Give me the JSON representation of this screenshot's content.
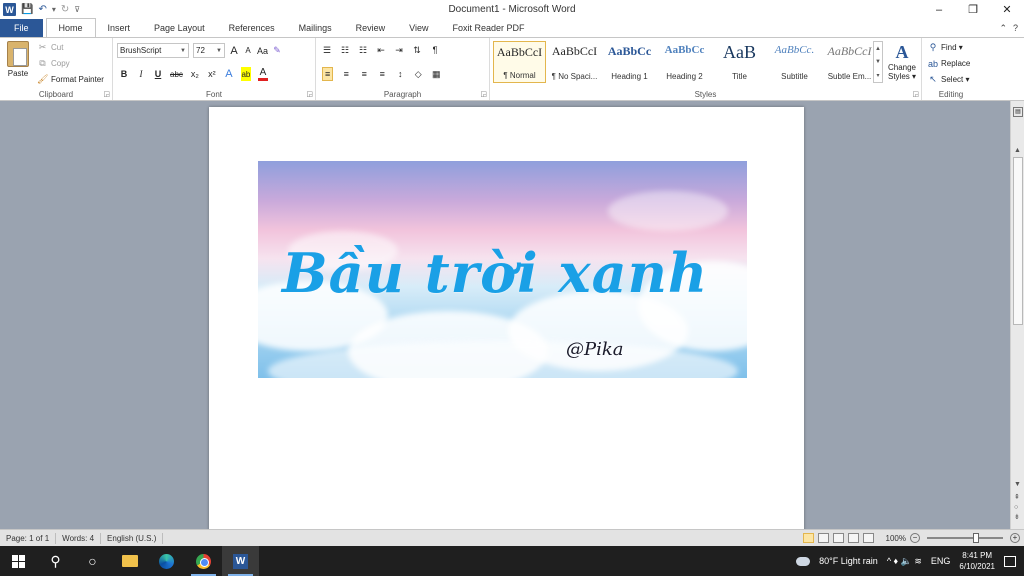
{
  "window": {
    "title": "Document1 - Microsoft Word",
    "app_letter": "W",
    "controls": [
      "–",
      "❐",
      "✕"
    ]
  },
  "tabs": [
    {
      "label": "File"
    },
    {
      "label": "Home"
    },
    {
      "label": "Insert"
    },
    {
      "label": "Page Layout"
    },
    {
      "label": "References"
    },
    {
      "label": "Mailings"
    },
    {
      "label": "Review"
    },
    {
      "label": "View"
    },
    {
      "label": "Foxit Reader PDF"
    }
  ],
  "tabs_right": [
    "⌃",
    "?"
  ],
  "clipboard": {
    "label": "Clipboard",
    "paste": "Paste",
    "cut": "Cut",
    "copy": "Copy",
    "format_painter": "Format Painter"
  },
  "font": {
    "label": "Font",
    "family": "BrushScript",
    "size": "72",
    "grow": "A",
    "shrink": "A",
    "case": "Aa",
    "clear": "✎",
    "bold": "B",
    "italic": "I",
    "underline": "U",
    "strike": "abc",
    "subscript": "x₂",
    "superscript": "x²",
    "effects": "A",
    "highlight": "ab",
    "color": "A"
  },
  "paragraph": {
    "label": "Paragraph",
    "bullets": "☰",
    "numbering": "☷",
    "multilevel": "☷",
    "dec_indent": "⇤",
    "inc_indent": "⇥",
    "sort": "⇅",
    "pilcrow": "¶",
    "align_left": "≡",
    "align_center": "≡",
    "align_right": "≡",
    "justify": "≡",
    "line_spacing": "↕",
    "shading": "◇",
    "borders": "▦"
  },
  "styles": {
    "label": "Styles",
    "items": [
      {
        "preview": "AaBbCcI",
        "name": "¶ Normal"
      },
      {
        "preview": "AaBbCcI",
        "name": "¶ No Spaci..."
      },
      {
        "preview": "AaBbCc",
        "name": "Heading 1"
      },
      {
        "preview": "AaBbCc",
        "name": "Heading 2"
      },
      {
        "preview": "AaB",
        "name": "Title"
      },
      {
        "preview": "AaBbCc.",
        "name": "Subtitle"
      },
      {
        "preview": "AaBbCcI",
        "name": "Subtle Em..."
      }
    ],
    "change_styles_1": "Change",
    "change_styles_2": "Styles ▾",
    "change_icon": "A"
  },
  "editing": {
    "label": "Editing",
    "find": "Find ▾",
    "replace": "Replace",
    "select": "Select ▾"
  },
  "document": {
    "banner_title": "Bầu trời xanh",
    "banner_sign": "@Pika"
  },
  "status": {
    "page": "Page: 1 of 1",
    "words": "Words: 4",
    "language": "English (U.S.)",
    "zoom": "100%",
    "zoom_out": "−",
    "zoom_in": "+"
  },
  "taskbar": {
    "weather": "80°F  Light rain",
    "lang": "ENG",
    "time": "8:41 PM",
    "date": "6/10/2021",
    "tray_icons": "^  ♦  🔈  ≋"
  },
  "colors": {
    "word_blue": "#2b5797",
    "title_text": "#1aa0e6",
    "selected_style": "#e3b64d"
  }
}
